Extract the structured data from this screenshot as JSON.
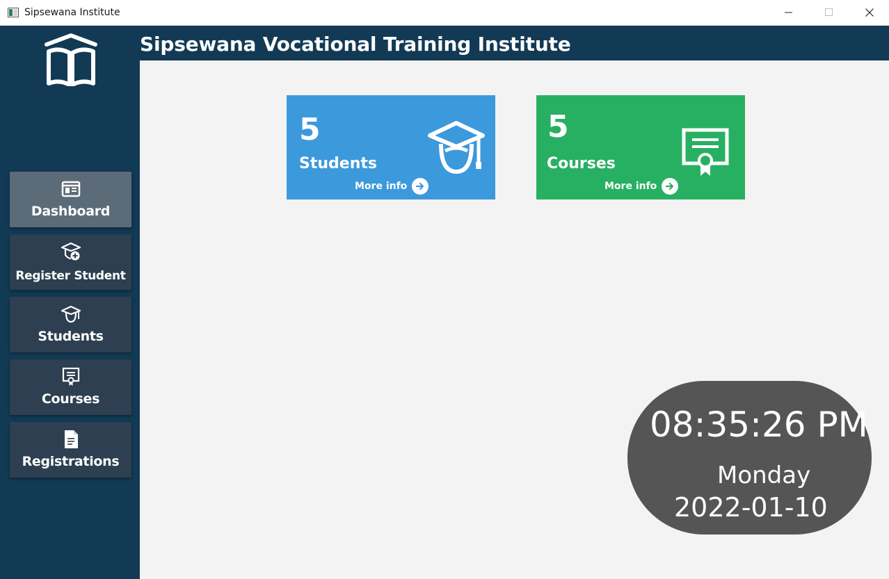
{
  "window": {
    "title": "Sipsewana Institute"
  },
  "header": {
    "title": "Sipsewana Vocational Training Institute"
  },
  "sidebar": {
    "items": [
      {
        "label": "Dashboard",
        "icon": "dashboard-icon",
        "active": true
      },
      {
        "label": "Register Student",
        "icon": "register-student-icon",
        "active": false
      },
      {
        "label": "Students",
        "icon": "student-cap-icon",
        "active": false
      },
      {
        "label": "Courses",
        "icon": "certificate-icon",
        "active": false
      },
      {
        "label": "Registrations",
        "icon": "document-icon",
        "active": false
      }
    ]
  },
  "cards": {
    "students": {
      "count": "5",
      "label": "Students",
      "more": "More info",
      "color": "#3c99dc"
    },
    "courses": {
      "count": "5",
      "label": "Courses",
      "more": "More info",
      "color": "#28b062"
    }
  },
  "clock": {
    "time": "08:35:26 PM",
    "day": "Monday",
    "date": "2022-01-10"
  },
  "colors": {
    "sidebar": "#123a55",
    "nav_button": "#2d3f50",
    "nav_active": "#5c6b78",
    "main_bg": "#f3f3f3",
    "clock_bg": "#555555"
  }
}
